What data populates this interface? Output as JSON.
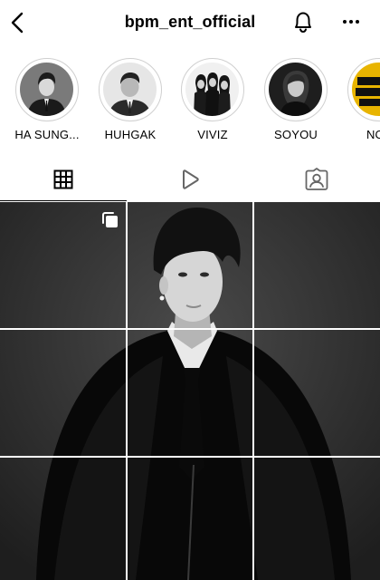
{
  "header": {
    "username": "bpm_ent_official"
  },
  "stories": [
    {
      "label": "HA SUNG..."
    },
    {
      "label": "HUHGAK"
    },
    {
      "label": "VIVIZ"
    },
    {
      "label": "SOYOU"
    },
    {
      "label": "NOT"
    }
  ],
  "tabs": [
    {
      "name": "posts",
      "icon": "grid-icon",
      "active": true
    },
    {
      "name": "reels",
      "icon": "play-icon",
      "active": false
    },
    {
      "name": "tagged",
      "icon": "tagged-person-icon",
      "active": false
    }
  ]
}
